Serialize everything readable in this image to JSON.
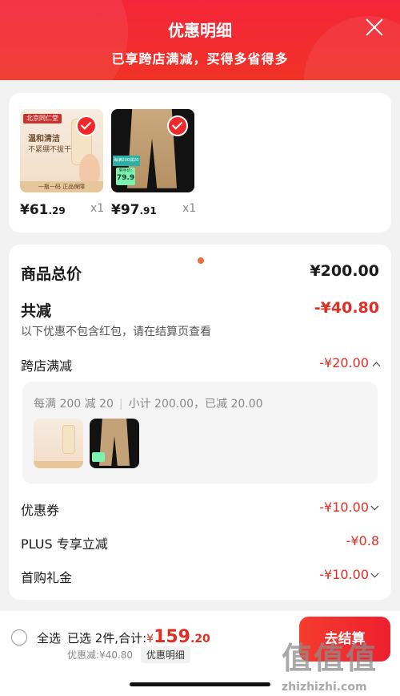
{
  "header": {
    "title": "优惠明细",
    "subtitle": "已享跨店满减，买得多省得多"
  },
  "products": [
    {
      "image_text_brand": "北京同仁堂",
      "image_text_1": "温和清洁",
      "image_text_2": "不紧绷不拔干",
      "image_text_bottom": "一瓶一码  正品保障",
      "price_main": "¥61",
      "price_decimal": ".29",
      "qty": "x1",
      "checked": true
    },
    {
      "image_text_1": "每满200减20",
      "image_text_2": "到手价:",
      "image_text_3": "79.9",
      "price_main": "¥97",
      "price_decimal": ".91",
      "qty": "x1",
      "checked": true
    }
  ],
  "summary": {
    "total_label": "商品总价",
    "total_value": "¥200.00",
    "discount_label": "共减",
    "discount_value": "-¥40.80",
    "note": "以下优惠不包含红包，请在结算页查看",
    "cross_store_label": "跨店满减",
    "cross_store_value": "-¥20.00",
    "rule": "每满 200 减 20",
    "subtotal": "小计 200.00，已减 20.00",
    "coupon_label": "优惠券",
    "coupon_value": "-¥10.00",
    "plus_label": "PLUS 专享立减",
    "plus_value": "-¥0.8",
    "first_label": "首购礼金",
    "first_value": "-¥10.00"
  },
  "footer": {
    "select_all": "全选",
    "selected_text": "已选 2件,合计:",
    "currency": "¥",
    "total_main": "159",
    "total_decimal": ".20",
    "discount_text": "优惠减:¥40.80",
    "detail_link": "优惠明细",
    "checkout": "去结算"
  },
  "watermark": {
    "text": "值",
    "url": "zhizhizhi.com"
  },
  "colors": {
    "accent": "#f03226",
    "discount": "#e02e24"
  }
}
